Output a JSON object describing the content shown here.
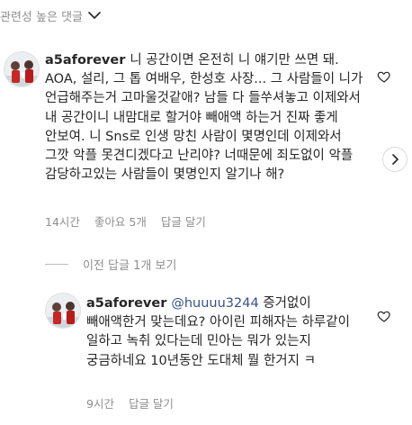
{
  "sort": {
    "label": "관련성 높은 댓글"
  },
  "comments": [
    {
      "username": "a5aforever",
      "text": "니 공간이면 온전히 니 얘기만 쓰면 돼. AOA, 설리, 그 톱 여배우, 한성호 사장... 그 사람들이 니가 언급해주는거 고마울것같애? 남들 다 들쑤셔놓고 이제와서 내 공간이니 내맘대로 할거야 빼애액 하는거 진짜 좋게 안보여. 니 Sns로 인생 망친 사람이 몇명인데 이제와서 그깟 악플 못견디겠다고 난리야? 너때문에 죄도없이 악플 감당하고있는 사람들이 몇명인지 알기나 해?",
      "time": "14시간",
      "likes": "좋아요 5개",
      "reply": "답글 달기"
    }
  ],
  "previous_replies": {
    "label": "이전 답글 1개 보기"
  },
  "replies": [
    {
      "username": "a5aforever",
      "mention": "@huuuu3244",
      "text": "증거없이 빼애액한거 맞는데요? 아이린 피해자는 하루같이 일하고 녹취 있다는데 민아는 뭐가 있는지 궁금하네요 10년동안 도대체 뭘 한거지 ㅋ",
      "time": "9시간",
      "reply": "답글 달기"
    }
  ],
  "colors": {
    "text": "#262626",
    "meta": "#8e8e8e",
    "mention": "#385185",
    "divider": "#bdbdbd",
    "avatar_red": "#c62828"
  },
  "icons": [
    "chevron-down-icon",
    "heart-icon",
    "chevron-right-icon",
    "avatar"
  ]
}
